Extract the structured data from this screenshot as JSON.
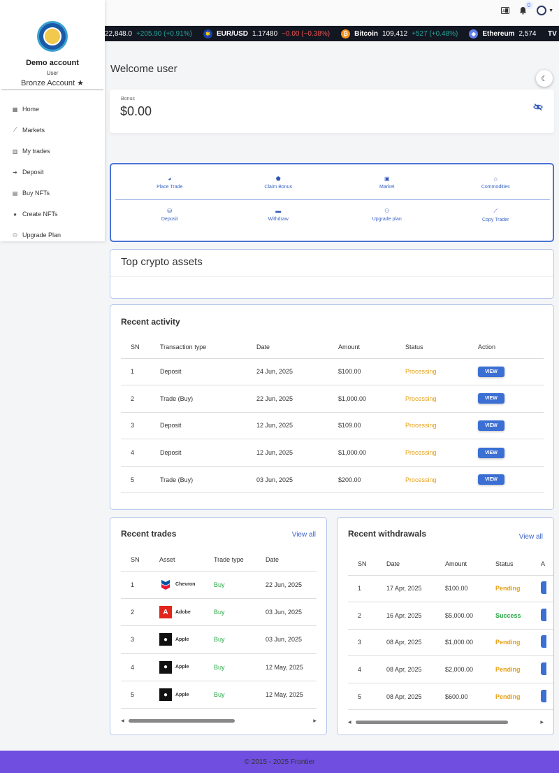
{
  "header": {
    "notifications_count": "0"
  },
  "ticker": [
    {
      "name": "",
      "value": "22,848.0",
      "change": "+205.90 (+0.91%)",
      "direction": "up"
    },
    {
      "name": "EUR/USD",
      "value": "1.17480",
      "change": "−0.00 (−0.38%)",
      "direction": "down",
      "icon": "eu-flag-icon"
    },
    {
      "name": "Bitcoin",
      "value": "109,412",
      "change": "+527 (+0.48%)",
      "direction": "up",
      "icon": "bitcoin-icon"
    },
    {
      "name": "Ethereum",
      "value": "2,574",
      "change": "",
      "direction": "up",
      "icon": "ethereum-icon"
    }
  ],
  "sidebar": {
    "account_name": "Demo account",
    "role": "User",
    "tier": "Bronze Account ★",
    "items": [
      {
        "label": "Home",
        "icon": "home-icon"
      },
      {
        "label": "Markets",
        "icon": "chart-line-icon"
      },
      {
        "label": "My trades",
        "icon": "bar-chart-icon"
      },
      {
        "label": "Deposit",
        "icon": "sign-in-icon"
      },
      {
        "label": "Buy NFTs",
        "icon": "image-icon"
      },
      {
        "label": "Create NFTs",
        "icon": "user-icon"
      },
      {
        "label": "Upgrade Plan",
        "icon": "users-icon"
      }
    ]
  },
  "main": {
    "welcome": "Welcome user",
    "bonus_label": "Bonus",
    "bonus_amount": "$0.00",
    "actions_row1": [
      "Place Trade",
      "Claim Bonus",
      "Market",
      "Commodities"
    ],
    "actions_row2": [
      "Deposit",
      "Withdraw",
      "Upgrade plan",
      "Copy Trader"
    ],
    "crypto_title": "Top crypto assets"
  },
  "activity": {
    "title": "Recent activity",
    "columns": [
      "SN",
      "Transaction type",
      "Date",
      "Amount",
      "Status",
      "Action"
    ],
    "rows": [
      {
        "sn": "1",
        "type": "Deposit",
        "date": "24 Jun, 2025",
        "amount": "$100.00",
        "status": "Processing",
        "action": "VIEW"
      },
      {
        "sn": "2",
        "type": "Trade (Buy)",
        "date": "22 Jun, 2025",
        "amount": "$1,000.00",
        "status": "Processing",
        "action": "VIEW"
      },
      {
        "sn": "3",
        "type": "Deposit",
        "date": "12 Jun, 2025",
        "amount": "$109.00",
        "status": "Processing",
        "action": "VIEW"
      },
      {
        "sn": "4",
        "type": "Deposit",
        "date": "12 Jun, 2025",
        "amount": "$1,000.00",
        "status": "Processing",
        "action": "VIEW"
      },
      {
        "sn": "5",
        "type": "Trade (Buy)",
        "date": "03 Jun, 2025",
        "amount": "$200.00",
        "status": "Processing",
        "action": "VIEW"
      }
    ]
  },
  "trades": {
    "title": "Recent trades",
    "view_all": "View all",
    "columns": [
      "SN",
      "Asset",
      "Trade type",
      "Date"
    ],
    "rows": [
      {
        "sn": "1",
        "asset": "Chevron",
        "logo": "chevron-logo",
        "type": "Buy",
        "date": "22 Jun, 2025"
      },
      {
        "sn": "2",
        "asset": "Adobe",
        "logo": "adobe-logo",
        "type": "Buy",
        "date": "03 Jun, 2025"
      },
      {
        "sn": "3",
        "asset": "Apple",
        "logo": "apple-logo",
        "type": "Buy",
        "date": "03 Jun, 2025"
      },
      {
        "sn": "4",
        "asset": "Apple",
        "logo": "apple-logo",
        "type": "Buy",
        "date": "12 May, 2025"
      },
      {
        "sn": "5",
        "asset": "Apple",
        "logo": "apple-logo",
        "type": "Buy",
        "date": "12 May, 2025"
      }
    ]
  },
  "withdrawals": {
    "title": "Recent withdrawals",
    "view_all": "View all",
    "columns": [
      "SN",
      "Date",
      "Amount",
      "Status",
      "A"
    ],
    "rows": [
      {
        "sn": "1",
        "date": "17 Apr, 2025",
        "amount": "$100.00",
        "status": "Pending"
      },
      {
        "sn": "2",
        "date": "16 Apr, 2025",
        "amount": "$5,000.00",
        "status": "Success"
      },
      {
        "sn": "3",
        "date": "08 Apr, 2025",
        "amount": "$1,000.00",
        "status": "Pending"
      },
      {
        "sn": "4",
        "date": "08 Apr, 2025",
        "amount": "$2,000.00",
        "status": "Pending"
      },
      {
        "sn": "5",
        "date": "08 Apr, 2025",
        "amount": "$600.00",
        "status": "Pending"
      }
    ]
  },
  "footer": {
    "text": "© 2015 - 2025 Frontier"
  },
  "colors": {
    "accent": "#3b6fd4",
    "footer": "#6f4ee0",
    "pending": "#e6a21a",
    "success": "#28a745"
  }
}
